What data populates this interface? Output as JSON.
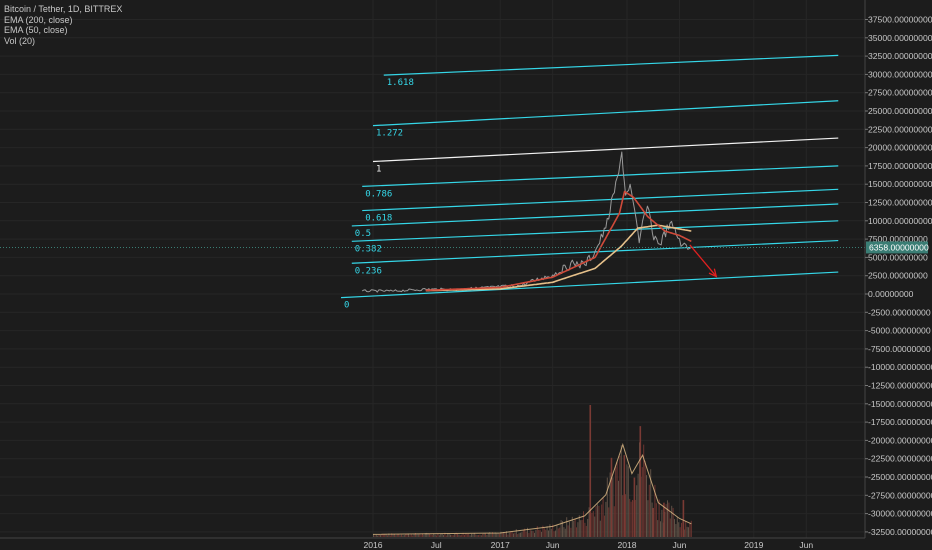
{
  "header": {
    "symbol": "Bitcoin / Tether, 1D, BITTREX",
    "studies": [
      "EMA (200, close)",
      "EMA (50, close)",
      "Vol (20)"
    ]
  },
  "colors": {
    "background": "#1c1c1c",
    "grid": "#262626",
    "axis_text": "#c8c8c8",
    "fib_line": "#35d7e8",
    "fib_one": "#f2f2f2",
    "price": "#9a9a9a",
    "ema_fast": "#d04a3a",
    "ema_slow": "#e6c08a",
    "arrow": "#e02020",
    "last_price_bg": "#3a7d74",
    "volume_up": "#6b5a4e",
    "volume_down": "#7a3a34"
  },
  "chart_data": {
    "type": "line",
    "title": "Bitcoin / Tether, 1D, BITTREX",
    "x_axis_labels": [
      "2016",
      "Jul",
      "2017",
      "Jun",
      "2018",
      "Jun",
      "2019",
      "Jun"
    ],
    "y_axis_labels": [
      "37500.00000000",
      "35000.00000000",
      "32500.00000000",
      "30000.00000000",
      "27500.00000000",
      "25000.00000000",
      "22500.00000000",
      "20000.00000000",
      "17500.00000000",
      "15000.00000000",
      "12500.00000000",
      "10000.00000000",
      "7500.00000000",
      "5000.00000000",
      "2500.00000000",
      "0.00000000",
      "-2500.00000000",
      "-5000.00000000",
      "-7500.00000000",
      "-10000.00000000",
      "-12500.00000000",
      "-15000.00000000",
      "-17500.00000000",
      "-20000.00000000",
      "-22500.00000000",
      "-25000.00000000",
      "-27500.00000000",
      "-30000.00000000",
      "-32500.00000000"
    ],
    "ylim": [
      -33000,
      39000
    ],
    "grid": true,
    "last_price": {
      "value": 6358,
      "label": "6358.00000000"
    },
    "price_series": {
      "name": "Bitcoin / Tether",
      "points": [
        [
          "2015-12",
          420
        ],
        [
          "2016-03",
          410
        ],
        [
          "2016-06",
          650
        ],
        [
          "2016-09",
          600
        ],
        [
          "2016-12",
          900
        ],
        [
          "2017-03",
          1150
        ],
        [
          "2017-05",
          2200
        ],
        [
          "2017-06",
          2600
        ],
        [
          "2017-08",
          4200
        ],
        [
          "2017-09",
          4000
        ],
        [
          "2017-10",
          5800
        ],
        [
          "2017-11",
          9000
        ],
        [
          "2017-12-08",
          16500
        ],
        [
          "2017-12-17",
          19400
        ],
        [
          "2017-12-28",
          13500
        ],
        [
          "2018-01-10",
          15000
        ],
        [
          "2018-02-05",
          7000
        ],
        [
          "2018-02-20",
          11000
        ],
        [
          "2018-03-05",
          11500
        ],
        [
          "2018-03-15",
          8300
        ],
        [
          "2018-04-05",
          6800
        ],
        [
          "2018-05-05",
          9700
        ],
        [
          "2018-06-10",
          6700
        ],
        [
          "2018-06-25",
          6100
        ],
        [
          "2018-07-05",
          6358
        ]
      ]
    },
    "ema_fast": {
      "name": "EMA (50, close)",
      "points": [
        [
          "2016-06",
          500
        ],
        [
          "2017-01",
          900
        ],
        [
          "2017-06",
          2300
        ],
        [
          "2017-10",
          5000
        ],
        [
          "2017-12-10",
          11000
        ],
        [
          "2017-12-25",
          14000
        ],
        [
          "2018-01-20",
          13200
        ],
        [
          "2018-03-01",
          10600
        ],
        [
          "2018-04-20",
          8600
        ],
        [
          "2018-06-01",
          8000
        ],
        [
          "2018-07-05",
          7200
        ]
      ]
    },
    "ema_slow": {
      "name": "EMA (200, close)",
      "points": [
        [
          "2016-06",
          460
        ],
        [
          "2017-01",
          700
        ],
        [
          "2017-06",
          1600
        ],
        [
          "2017-10",
          3500
        ],
        [
          "2017-12-15",
          6500
        ],
        [
          "2018-02-01",
          9000
        ],
        [
          "2018-04-01",
          9400
        ],
        [
          "2018-07-05",
          8600
        ]
      ]
    },
    "fib_levels": [
      {
        "label": "0",
        "start": [
          "2015-10",
          -500
        ],
        "end": [
          "2019-09",
          3000
        ]
      },
      {
        "label": "0.236",
        "start": [
          "2015-11",
          4200
        ],
        "end": [
          "2019-09",
          7300
        ]
      },
      {
        "label": "0.382",
        "start": [
          "2015-11",
          7200
        ],
        "end": [
          "2019-09",
          10000
        ]
      },
      {
        "label": "0.5",
        "start": [
          "2015-11",
          9300
        ],
        "end": [
          "2019-09",
          12300
        ]
      },
      {
        "label": "0.618",
        "start": [
          "2015-12",
          11400
        ],
        "end": [
          "2019-09",
          14300
        ]
      },
      {
        "label": "0.786",
        "start": [
          "2015-12",
          14700
        ],
        "end": [
          "2019-09",
          17500
        ]
      },
      {
        "label": "1",
        "start": [
          "2016-01",
          18100
        ],
        "end": [
          "2019-09",
          21300
        ]
      },
      {
        "label": "1.272",
        "start": [
          "2016-01",
          23000
        ],
        "end": [
          "2019-09",
          26400
        ]
      },
      {
        "label": "1.618",
        "start": [
          "2016-02",
          29900
        ],
        "end": [
          "2019-09",
          32600
        ]
      }
    ],
    "arrow": {
      "start": [
        "2018-07-01",
        6700
      ],
      "end": [
        "2018-09-15",
        2400
      ]
    },
    "volume": {
      "name": "Vol (20)",
      "scale_max": 100,
      "profile": [
        [
          "2016-01",
          2
        ],
        [
          "2017-01",
          3
        ],
        [
          "2017-06",
          8
        ],
        [
          "2017-09",
          16
        ],
        [
          "2017-11",
          32
        ],
        [
          "2017-12-20",
          70
        ],
        [
          "2018-01-15",
          48
        ],
        [
          "2018-02-15",
          62
        ],
        [
          "2018-04-01",
          26
        ],
        [
          "2018-06-01",
          14
        ],
        [
          "2018-07-05",
          10
        ]
      ],
      "spikes": [
        [
          "2017-09-15",
          100
        ],
        [
          "2017-11-15",
          60
        ],
        [
          "2017-12-22",
          62
        ],
        [
          "2018-01-20",
          45
        ],
        [
          "2018-02-06",
          84
        ],
        [
          "2018-03-15",
          22
        ],
        [
          "2018-04-15",
          26
        ],
        [
          "2018-06-10",
          28
        ]
      ]
    }
  }
}
